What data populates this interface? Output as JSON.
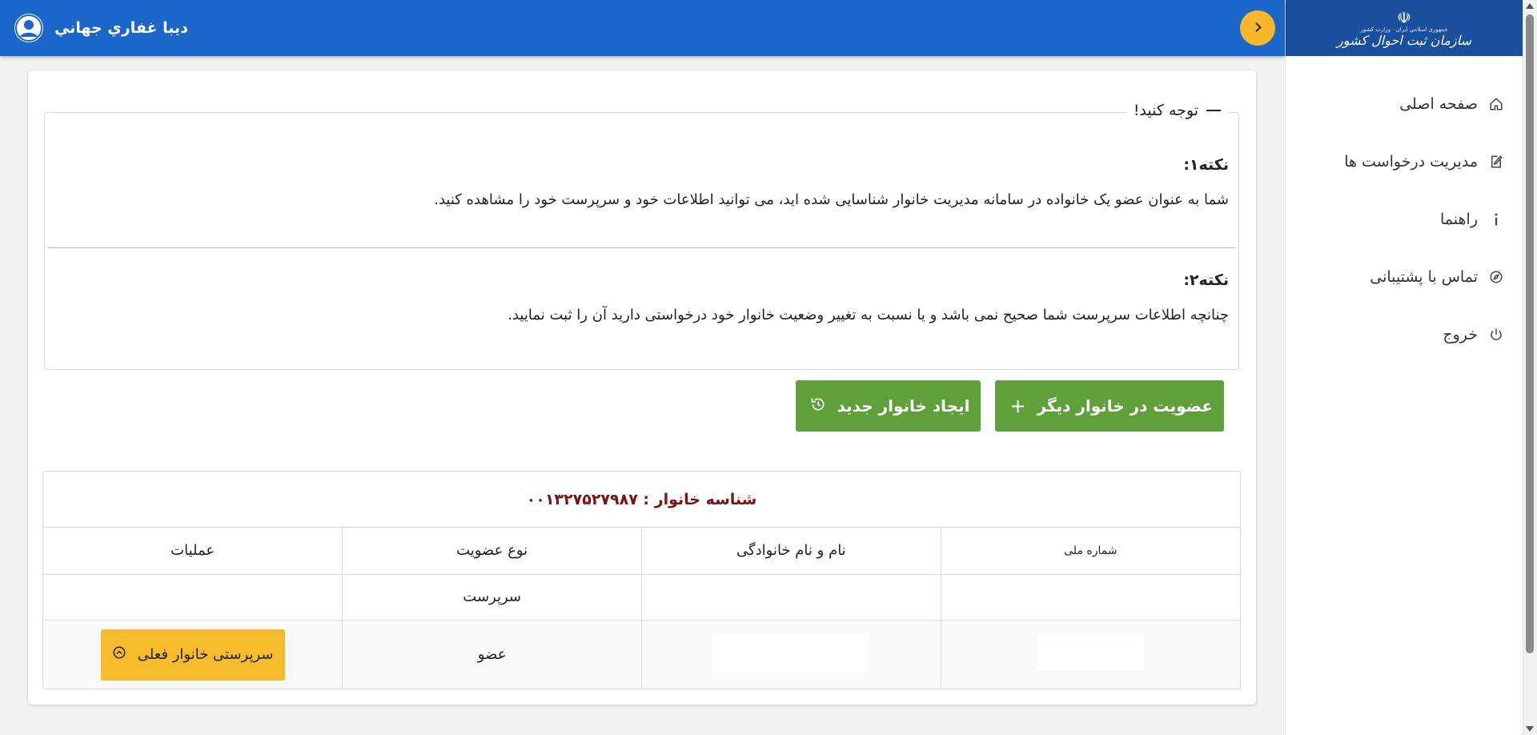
{
  "header": {
    "user_name": "دیبا غفاري جهاني"
  },
  "sidebar": {
    "logo": {
      "sub": "جمهوری اسلامی ایران · وزارت کشور",
      "main": "سازمان ثبت احوال کشور"
    },
    "items": [
      {
        "label": "صفحه اصلی",
        "icon": "home-icon"
      },
      {
        "label": "مدیریت درخواست ها",
        "icon": "edit-icon"
      },
      {
        "label": "راهنما",
        "icon": "info-icon"
      },
      {
        "label": "تماس با پشتیبانی",
        "icon": "compass-icon"
      },
      {
        "label": "خروج",
        "icon": "power-icon"
      }
    ]
  },
  "notice": {
    "title": "توجه کنید!",
    "note1_title": "نکته۱:",
    "note1_text": "شما به عنوان عضو یک خانواده در سامانه مدیریت خانوار شناسایی شده اید، می توانید اطلاعات خود و سرپرست خود را مشاهده کنید.",
    "note2_title": "نکته۲:",
    "note2_text": "چنانچه اطلاعات سرپرست شما صحیح نمی باشد و یا نسبت به تغییر وضعیت خانوار خود درخواستی دارید آن را ثبت نمایید."
  },
  "actions": {
    "join_other": "عضویت در خانوار دیگر",
    "create_new": "ایجاد خانوار جدید"
  },
  "family": {
    "id_text": "شناسه خانوار : ۰۰۱۳۲۷۵۲۷۹۸۷",
    "columns": [
      "شماره ملی",
      "نام و نام خانوادگی",
      "نوع عضویت",
      "عملیات"
    ],
    "rows": [
      {
        "national_id": "",
        "name": "",
        "membership": "سرپرست",
        "action": ""
      },
      {
        "national_id": "",
        "name": "",
        "membership": "عضو",
        "action": "سرپرستی خانوار فعلی"
      }
    ]
  },
  "colors": {
    "header_blue": "#1a67c9",
    "logo_blue": "#1a4f9e",
    "accent_yellow": "#f6b82a",
    "button_green": "#5fa03b",
    "family_id_red": "#7a1414"
  }
}
